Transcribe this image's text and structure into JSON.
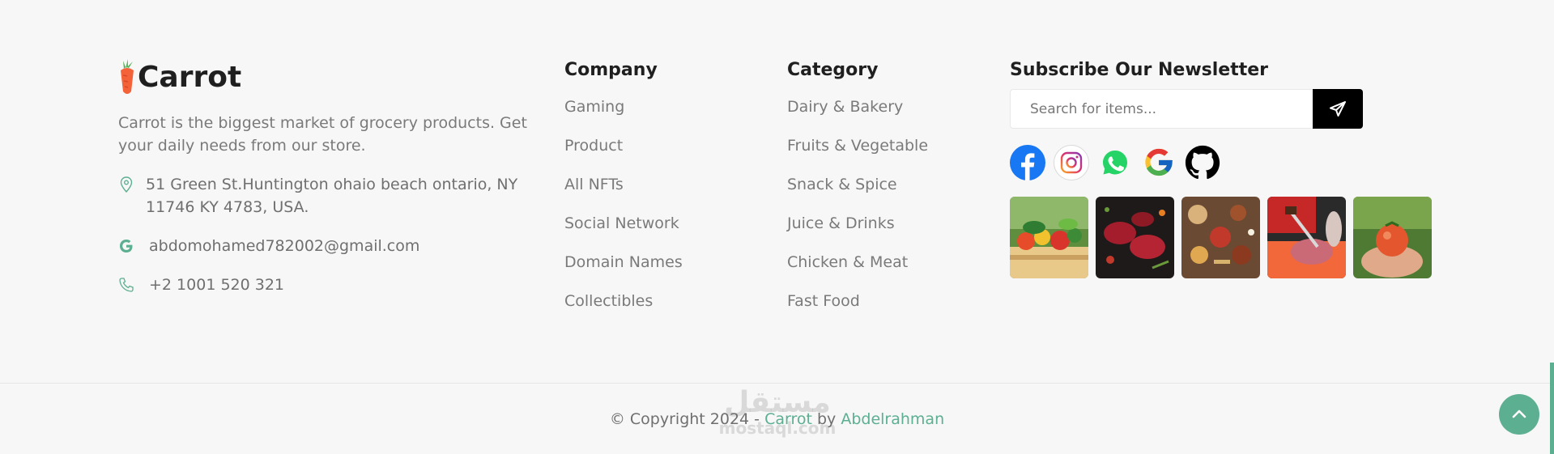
{
  "brand": {
    "name": "Carrot"
  },
  "about": {
    "text": "Carrot is the biggest market of grocery products. Get your daily needs from our store."
  },
  "contact": {
    "address": "51 Green St.Huntington ohaio beach ontario, NY 11746 KY 4783, USA.",
    "email": "abdomohamed782002@gmail.com",
    "phone": "+2 1001 520 321"
  },
  "company": {
    "title": "Company",
    "links": [
      "Gaming",
      "Product",
      "All NFTs",
      "Social Network",
      "Domain Names",
      "Collectibles"
    ]
  },
  "category": {
    "title": "Category",
    "links": [
      "Dairy & Bakery",
      "Fruits & Vegetable",
      "Snack & Spice",
      "Juice & Drinks",
      "Chicken & Meat",
      "Fast Food"
    ]
  },
  "newsletter": {
    "title": "Subscribe Our Newsletter",
    "placeholder": "Search for items..."
  },
  "socials": [
    "facebook-icon",
    "instagram-icon",
    "whatsapp-icon",
    "google-icon",
    "github-icon"
  ],
  "gallery": [
    "vegetables-crate",
    "raw-meat-spices",
    "spices-assortment",
    "butcher-cutting-meat",
    "tomato-in-hands"
  ],
  "footer": {
    "copyright_prefix": "© Copyright 2024 - ",
    "brand_link": "Carrot",
    "by": " by ",
    "author": "Abdelrahman"
  },
  "watermark": {
    "arabic": "مستقل",
    "latin": "mostaql.com"
  },
  "colors": {
    "accent": "#5caf90",
    "dark": "#1f1f1f",
    "text": "#7a7a7a",
    "background": "#f7f7f7"
  }
}
